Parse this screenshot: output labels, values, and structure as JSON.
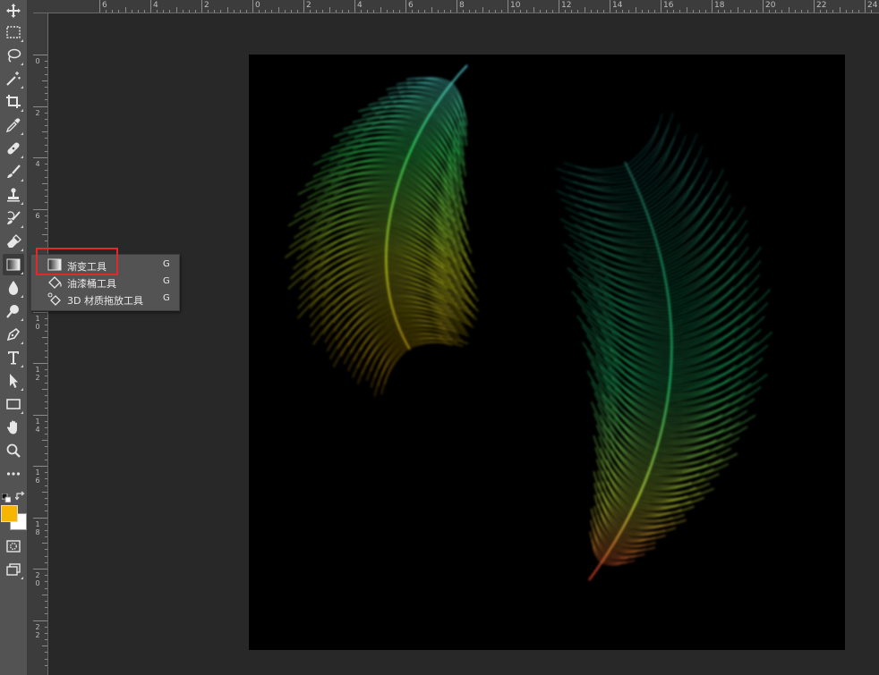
{
  "toolbar": {
    "tools": [
      {
        "name": "move-tool",
        "icon": "move-icon"
      },
      {
        "name": "marquee-tool",
        "icon": "rectangle-marquee-icon"
      },
      {
        "name": "lasso-tool",
        "icon": "lasso-icon"
      },
      {
        "name": "magic-wand-tool",
        "icon": "magic-wand-icon"
      },
      {
        "name": "crop-tool",
        "icon": "crop-icon"
      },
      {
        "name": "eyedropper-tool",
        "icon": "eyedropper-icon"
      },
      {
        "name": "healing-brush-tool",
        "icon": "bandage-icon"
      },
      {
        "name": "brush-tool",
        "icon": "brush-icon"
      },
      {
        "name": "stamp-tool",
        "icon": "stamp-icon"
      },
      {
        "name": "history-brush-tool",
        "icon": "history-brush-icon"
      },
      {
        "name": "eraser-tool",
        "icon": "eraser-icon"
      },
      {
        "name": "gradient-tool",
        "icon": "gradient-icon"
      },
      {
        "name": "blur-tool",
        "icon": "droplet-icon"
      },
      {
        "name": "dodge-tool",
        "icon": "dodge-icon"
      },
      {
        "name": "pen-tool",
        "icon": "pen-icon"
      },
      {
        "name": "type-tool",
        "icon": "type-icon"
      },
      {
        "name": "path-selection-tool",
        "icon": "arrow-cursor-icon"
      },
      {
        "name": "rectangle-tool",
        "icon": "rectangle-icon"
      },
      {
        "name": "hand-tool",
        "icon": "hand-icon"
      },
      {
        "name": "zoom-tool",
        "icon": "magnifier-icon"
      },
      {
        "name": "more-tools",
        "icon": "ellipsis-icon"
      }
    ],
    "foreground_color": "#f7b500",
    "background_color": "#ffffff"
  },
  "ruler_top": {
    "labels": [
      "6",
      "4",
      "2",
      "0",
      "2",
      "4",
      "6",
      "8",
      "10",
      "12",
      "14",
      "16",
      "18",
      "20",
      "22",
      "24"
    ]
  },
  "ruler_left": {
    "labels": [
      "0",
      "2",
      "4",
      "6",
      "8",
      "10",
      "12",
      "14",
      "16",
      "18",
      "20",
      "22",
      "24"
    ]
  },
  "flyout": {
    "items": [
      {
        "label": "渐变工具",
        "shortcut": "G",
        "icon": "gradient-icon"
      },
      {
        "label": "油漆桶工具",
        "shortcut": "G",
        "icon": "paint-bucket-icon"
      },
      {
        "label": "3D 材质拖放工具",
        "shortcut": "G",
        "icon": "material-drop-icon"
      }
    ]
  },
  "canvas": {
    "background": "#000000",
    "feather_left_colors": [
      "#5ee8ff",
      "#39ff6a",
      "#d8e820",
      "#c8a010",
      "#b83010"
    ],
    "feather_right_colors": [
      "#1a6a66",
      "#22e07a",
      "#e6ff40",
      "#ff3a2a"
    ]
  }
}
